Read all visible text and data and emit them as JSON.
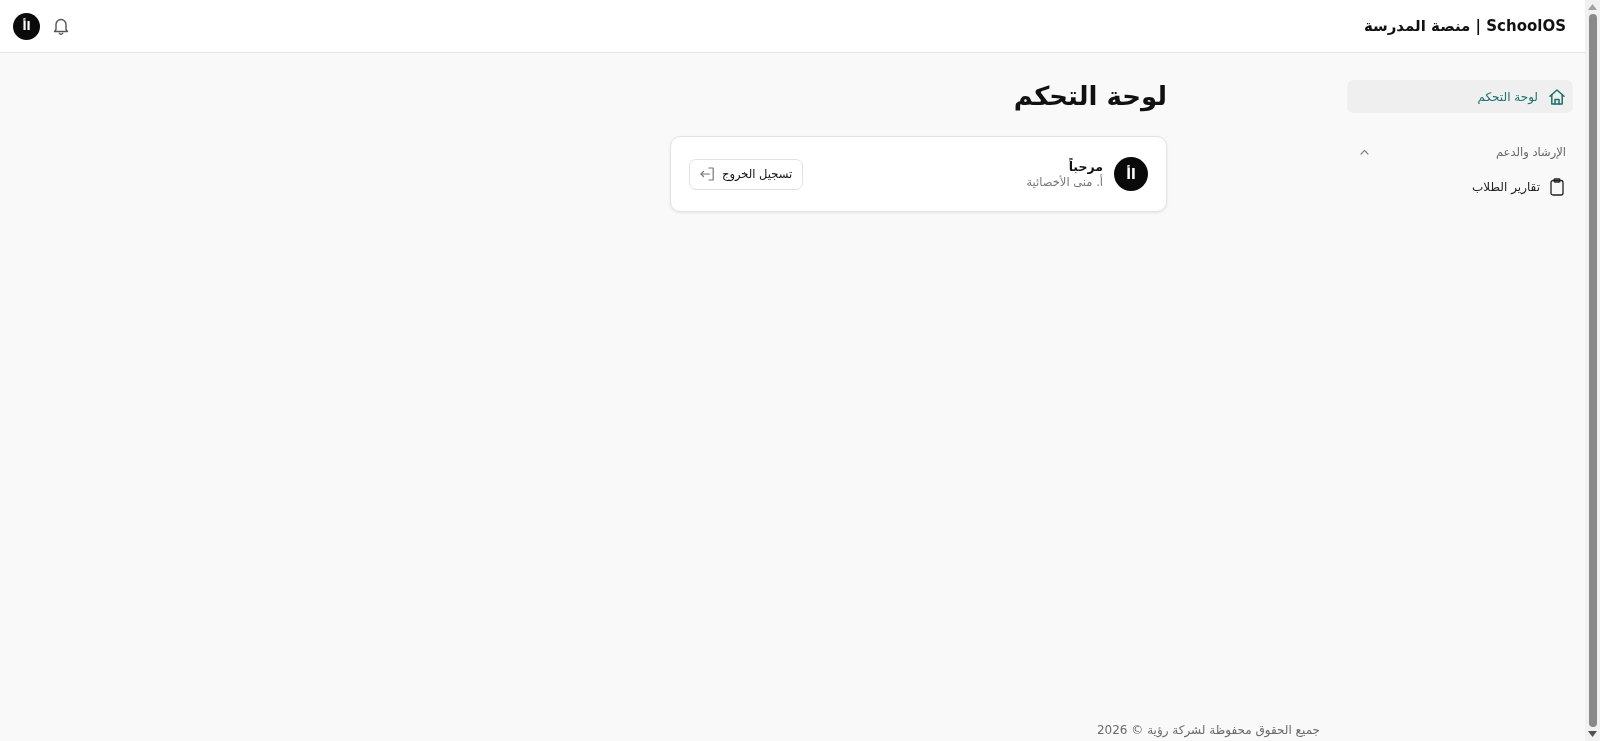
{
  "topbar": {
    "brand": "SchoolOS | منصة المدرسة",
    "avatar_initials": "اأ"
  },
  "sidebar": {
    "items": [
      {
        "kind": "link",
        "label": "لوحة التحكم",
        "selected": true
      },
      {
        "kind": "section",
        "label": "الإرشاد والدعم",
        "expanded": true,
        "children": [
          {
            "kind": "link",
            "label": "تقارير الطلاب",
            "selected": false
          }
        ]
      }
    ]
  },
  "main": {
    "title": "لوحة التحكم",
    "welcome_card": {
      "avatar_initials": "اأ",
      "greeting": "مرحباً",
      "name": "أ. منى الأخصائية",
      "logout_button": "تسجيل الخروج"
    }
  },
  "footer": {
    "copyright": "جميع الحقوق محفوظة لشركة رؤية © 2026"
  }
}
